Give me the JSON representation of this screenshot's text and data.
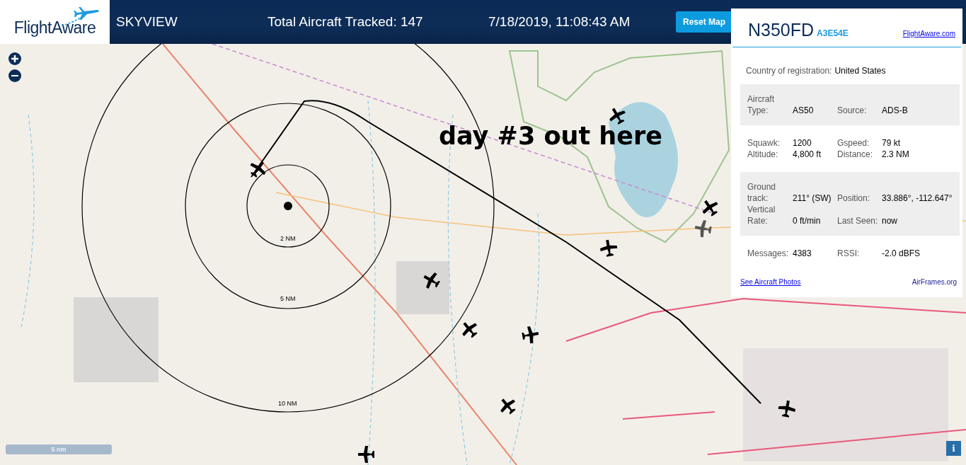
{
  "header": {
    "logo": "FlightAware",
    "app_name": "SKYVIEW",
    "total": "Total Aircraft Tracked: 147",
    "datetime": "7/18/2019, 11:08:43 AM",
    "reset_button": "Reset Map"
  },
  "map": {
    "ring_labels": [
      "2 NM",
      "5 NM",
      "10 NM"
    ],
    "annotation": "day #3 out here",
    "scale": "5 nm",
    "info_button": "i"
  },
  "panel": {
    "callsign": "N350FD",
    "hex": "A3E54E",
    "link": "FlightAware.com",
    "country_label": "Country of registration:",
    "country": "United States",
    "sections": [
      {
        "shaded": true,
        "cells": [
          {
            "label": "Aircraft Type:",
            "value": "AS50"
          },
          {
            "label": "Source:",
            "value": "ADS-B"
          }
        ]
      },
      {
        "shaded": false,
        "cells": [
          {
            "label": "Squawk:",
            "value": "1200"
          },
          {
            "label": "Gspeed:",
            "value": "79 kt"
          },
          {
            "label": "Altitude:",
            "value": "4,800 ft"
          },
          {
            "label": "Distance:",
            "value": "2.3 NM"
          }
        ]
      },
      {
        "shaded": true,
        "cells": [
          {
            "label": "Ground track:",
            "value": "211° (SW)"
          },
          {
            "label": "Position:",
            "value": "33.886°, -112.647°"
          },
          {
            "label": "Vertical Rate:",
            "value": "0 ft/min"
          },
          {
            "label": "Last Seen:",
            "value": "now"
          }
        ]
      },
      {
        "shaded": false,
        "cells": [
          {
            "label": "Messages:",
            "value": "4383"
          },
          {
            "label": "RSSI:",
            "value": "-2.0 dBFS"
          }
        ]
      }
    ],
    "photos_link": "See Aircraft Photos",
    "airframes_link": "AirFrames.org"
  }
}
